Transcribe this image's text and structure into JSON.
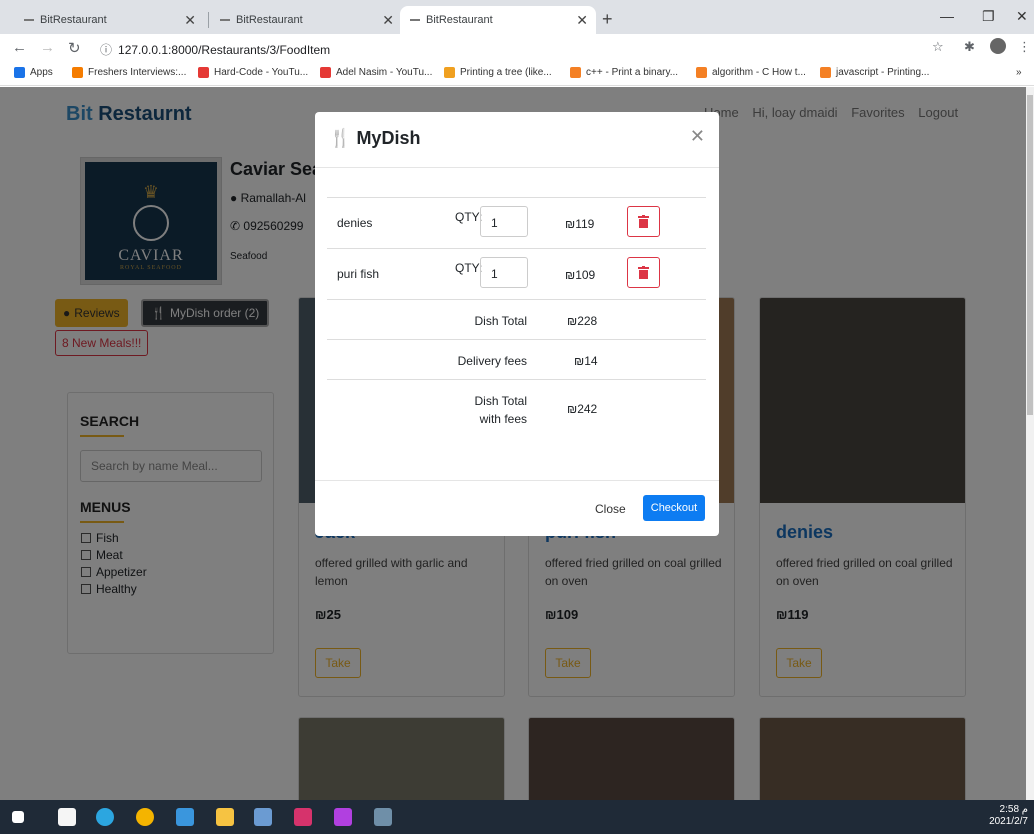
{
  "browser": {
    "tabs": [
      {
        "label": "BitRestaurant",
        "active": false
      },
      {
        "label": "BitRestaurant",
        "active": false
      },
      {
        "label": "BitRestaurant",
        "active": true
      }
    ],
    "url": "127.0.0.1:8000/Restaurants/3/FoodItem",
    "bookmarks": [
      {
        "label": "Apps",
        "icon": "apps-icon",
        "color": "#1a73e8"
      },
      {
        "label": "Freshers Interviews:...",
        "icon": "blogger-icon",
        "color": "#f57c00"
      },
      {
        "label": "Hard-Code - YouTu...",
        "icon": "youtube-icon",
        "color": "#e53935"
      },
      {
        "label": "Adel Nasim - YouTu...",
        "icon": "youtube-icon",
        "color": "#e53935"
      },
      {
        "label": "Printing a tree (like...",
        "icon": "tree-icon",
        "color": "#f0a020"
      },
      {
        "label": "c++ - Print a binary...",
        "icon": "stackoverflow-icon",
        "color": "#f48024"
      },
      {
        "label": "algorithm - C How t...",
        "icon": "stackoverflow-icon",
        "color": "#f48024"
      },
      {
        "label": "javascript - Printing...",
        "icon": "stackoverflow-icon",
        "color": "#f48024"
      }
    ]
  },
  "site": {
    "brand_bit": "Bit",
    "brand_rest": " Restaurnt",
    "nav": {
      "home": "Home",
      "greeting": "Hi, loay dmaidi",
      "favorites": "Favorites",
      "logout": "Logout"
    }
  },
  "restaurant": {
    "name": "Caviar Seafood",
    "location": "Ramallah-Al",
    "phone": "092560299",
    "category": "Seafood",
    "logo_name": "CAVIAR",
    "logo_sub": "ROYAL SEAFOOD"
  },
  "actions": {
    "reviews": "Reviews",
    "mydish": "MyDish order (2)",
    "new_meals": "8 New Meals!!!"
  },
  "sidebar": {
    "search_heading": "SEARCH",
    "search_placeholder": "Search by name Meal...",
    "menus_heading": "MENUS",
    "menus": [
      "Fish",
      "Meat",
      "Appetizer",
      "Healthy"
    ]
  },
  "cards": [
    {
      "title": "Jack",
      "desc": "offered grilled with garlic and lemon",
      "price": "₪25",
      "take": "Take",
      "img_color": "#51606c"
    },
    {
      "title": "puri fish",
      "desc": "offered fried grilled on coal grilled on oven",
      "price": "₪109",
      "take": "Take",
      "img_color": "#a07a55"
    },
    {
      "title": "denies",
      "desc": "offered fried grilled on coal grilled on oven",
      "price": "₪119",
      "take": "Take",
      "img_color": "#4b4640"
    }
  ],
  "modal": {
    "title": "MyDish",
    "items": [
      {
        "name": "denies",
        "qty_label": "QTY:",
        "qty": "1",
        "price": "₪119"
      },
      {
        "name": "puri fish",
        "qty_label": "QTY:",
        "qty": "1",
        "price": "₪109"
      }
    ],
    "dish_total_label": "Dish Total",
    "dish_total": "₪228",
    "delivery_label": "Delivery fees",
    "delivery": "₪14",
    "total_label_1": "Dish Total",
    "total_label_2": "with fees",
    "total": "₪242",
    "close": "Close",
    "checkout": "Checkout"
  },
  "taskbar": {
    "time": "2:58 م",
    "date": "2021/2/7"
  }
}
